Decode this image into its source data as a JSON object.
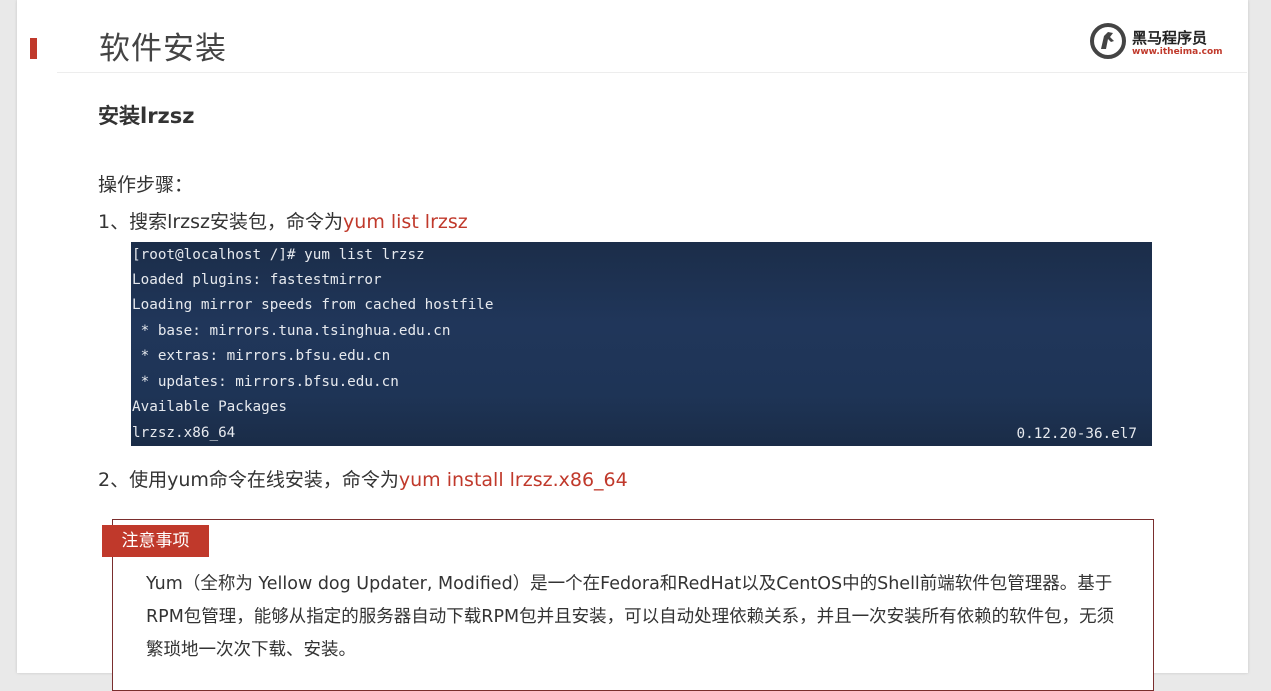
{
  "slide": {
    "title": "软件安装",
    "logo": {
      "name": "黑马程序员",
      "url": "www.itheima.com"
    },
    "section_title": "安装lrzsz",
    "steps_label": "操作步骤：",
    "step1": {
      "text": "1、搜索lrzsz安装包，命令为",
      "command": "yum list lrzsz"
    },
    "terminal": {
      "lines": [
        "[root@localhost /]# yum list lrzsz",
        "Loaded plugins: fastestmirror",
        "Loading mirror speeds from cached hostfile",
        " * base: mirrors.tuna.tsinghua.edu.cn",
        " * extras: mirrors.bfsu.edu.cn",
        " * updates: mirrors.bfsu.edu.cn",
        "Available Packages",
        "lrzsz.x86_64"
      ],
      "version": "0.12.20-36.el7"
    },
    "step2": {
      "text": "2、使用yum命令在线安装，命令为",
      "command": "yum install lrzsz.x86_64"
    },
    "note": {
      "tag": "注意事项",
      "lines": [
        "Yum（全称为 Yellow dog Updater, Modified）是一个在Fedora和RedHat以及CentOS中的Shell前端软件包管理器。基于",
        "RPM包管理，能够从指定的服务器自动下载RPM包并且安装，可以自动处理依赖关系，并且一次安装所有依赖的软件包，无须",
        "繁琐地一次次下载、安装。"
      ]
    },
    "colors": {
      "accent": "#c0392b",
      "terminal_bg": "#1e3456"
    }
  }
}
